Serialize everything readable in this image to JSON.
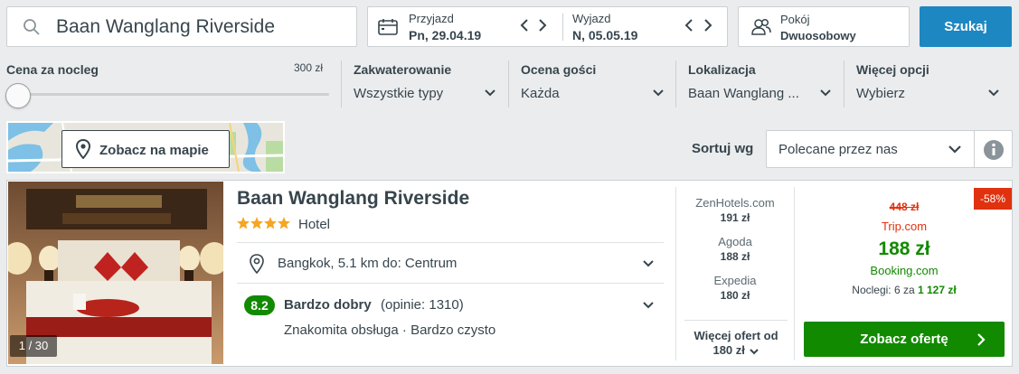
{
  "search": {
    "destination": "Baan Wanglang Riverside",
    "icon": "search-icon"
  },
  "dates": {
    "checkin_label": "Przyjazd",
    "checkin_value": "Pn, 29.04.19",
    "checkout_label": "Wyjazd",
    "checkout_value": "N, 05.05.19"
  },
  "rooms": {
    "label": "Pokój",
    "value": "Dwuosobowy"
  },
  "search_button": "Szukaj",
  "filters": {
    "price_label": "Cena za nocleg",
    "price_max": "300 zł",
    "price_slider_value": 0,
    "accommodation_label": "Zakwaterowanie",
    "accommodation_value": "Wszystkie typy",
    "guest_rating_label": "Ocena gości",
    "guest_rating_value": "Każda",
    "location_label": "Lokalizacja",
    "location_value": "Baan Wanglang ...",
    "more_label": "Więcej opcji",
    "more_value": "Wybierz"
  },
  "map": {
    "button_label": "Zobacz na mapie"
  },
  "sort": {
    "label": "Sortuj wg",
    "value": "Polecane przez nas"
  },
  "hotel": {
    "name": "Baan Wanglang Riverside",
    "stars": 4,
    "type": "Hotel",
    "location": "Bangkok, 5.1 km do: Centrum",
    "rating_score": "8.2",
    "rating_label": "Bardzo dobry",
    "rating_reviews": "(opinie: 1310)",
    "highlights": "Znakomita obsługa · Bardzo czysto",
    "photo_counter": "1 / 30"
  },
  "deals": [
    {
      "site": "ZenHotels.com",
      "price": "191 zł"
    },
    {
      "site": "Agoda",
      "price": "188 zł"
    },
    {
      "site": "Expedia",
      "price": "180 zł"
    }
  ],
  "more_offers": {
    "line1": "Więcej ofert od",
    "line2": "180 zł"
  },
  "best_deal": {
    "discount": "-58%",
    "old_price": "448 zł",
    "old_site": "Trip.com",
    "price": "188 zł",
    "site": "Booking.com",
    "nights_prefix": "Noclegi: 6 za",
    "nights_total": "1 127 zł",
    "button_label": "Zobacz ofertę"
  },
  "colors": {
    "primary_blue": "#1d87c1",
    "deal_green": "#128a00",
    "discount_red": "#e0320f",
    "text": "#37454d"
  }
}
